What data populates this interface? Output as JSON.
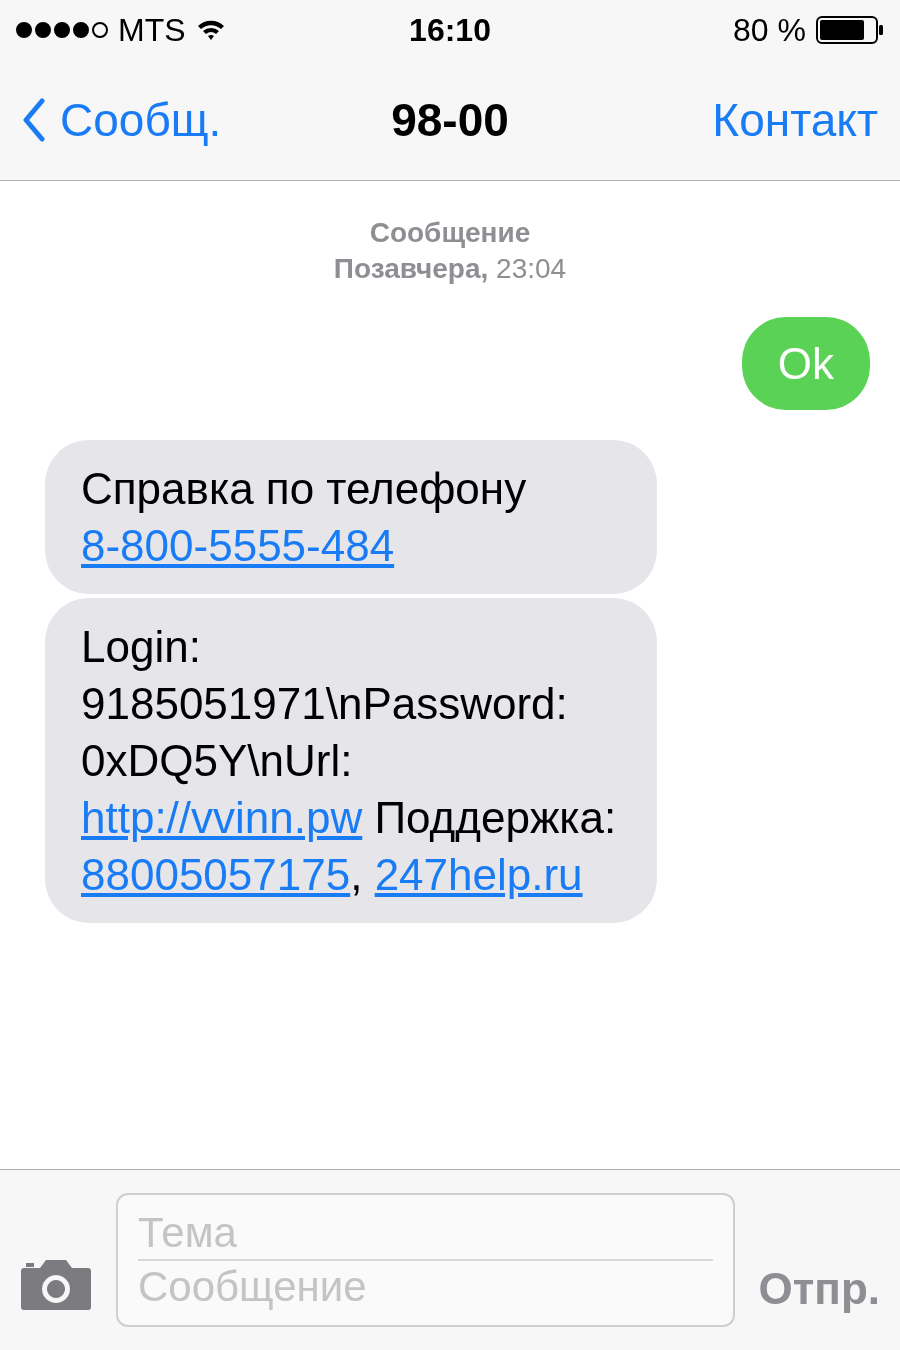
{
  "status_bar": {
    "signal_dots": [
      {
        "filled": true
      },
      {
        "filled": true
      },
      {
        "filled": true
      },
      {
        "filled": true
      },
      {
        "filled": false
      }
    ],
    "carrier": "MTS",
    "time": "16:10",
    "battery": "80 %"
  },
  "nav": {
    "back": "Сообщ.",
    "title": "98-00",
    "action": "Контакт"
  },
  "thread_header": {
    "label": "Сообщение",
    "date": "**Позавчера,** 23:04"
  },
  "messages": [
    {
      "kind": "outgoing",
      "parts": [
        {
          "kind": "text",
          "text": "Ok"
        }
      ]
    },
    {
      "kind": "incoming",
      "parts": [
        {
          "kind": "text",
          "text": "Справка по телефону "
        },
        {
          "kind": "link",
          "text": "8-800-5555-484"
        }
      ]
    },
    {
      "kind": "incoming",
      "parts": [
        {
          "kind": "text",
          "text": "Login: 9185051971\\nPassword: 0xDQ5Y\\nUrl: "
        },
        {
          "kind": "link",
          "text": "http://vvinn.pw"
        },
        {
          "kind": "text",
          "text": " Поддержка: "
        },
        {
          "kind": "link",
          "text": "88005057175"
        },
        {
          "kind": "text",
          "text": ", "
        },
        {
          "kind": "link",
          "text": "247help.ru"
        }
      ]
    }
  ],
  "compose": {
    "subject_placeholder": "Тема",
    "message_placeholder": "Сообщение",
    "send": "Отпр.",
    "send_disabled": true
  }
}
